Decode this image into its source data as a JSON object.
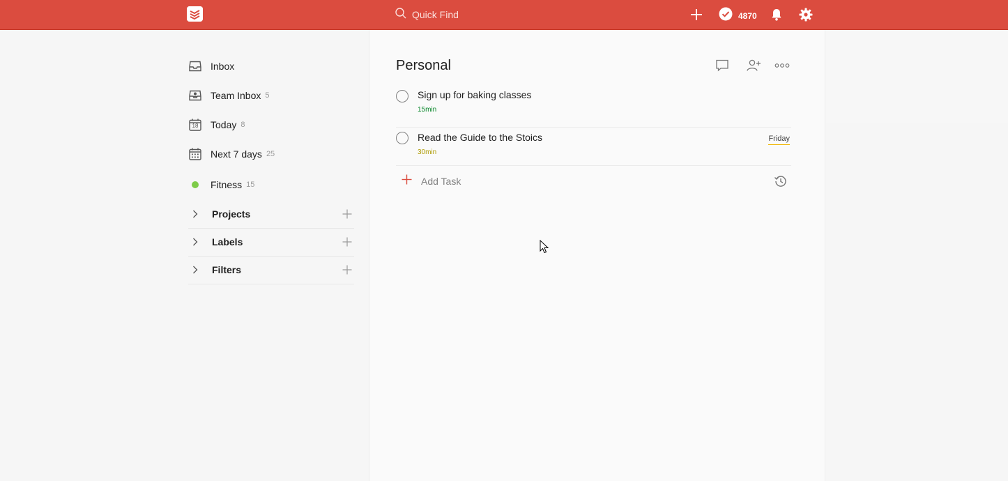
{
  "topbar": {
    "search_placeholder": "Quick Find",
    "karma_points": "4870",
    "brand_color": "#db4c3f",
    "icons": [
      "todoist-logo-icon",
      "search-icon",
      "add-icon",
      "karma-check-icon",
      "bell-icon",
      "gear-icon"
    ]
  },
  "sidebar": {
    "items": [
      {
        "label": "Inbox",
        "count": "",
        "icon": "inbox-icon"
      },
      {
        "label": "Team Inbox",
        "count": "5",
        "icon": "team-inbox-icon"
      },
      {
        "label": "Today",
        "count": "8",
        "icon": "calendar-today-icon",
        "day": "18"
      },
      {
        "label": "Next 7 days",
        "count": "25",
        "icon": "calendar-week-icon"
      },
      {
        "label": "Fitness",
        "count": "15",
        "icon": "project-dot-icon",
        "dot_color": "#7ecc49"
      }
    ],
    "sections": [
      {
        "label": "Projects"
      },
      {
        "label": "Labels"
      },
      {
        "label": "Filters"
      }
    ]
  },
  "main": {
    "title": "Personal",
    "tasks": [
      {
        "content": "Sign up for baking classes",
        "duration": "15min",
        "duration_color": "#058527",
        "due": ""
      },
      {
        "content": "Read the Guide to the Stoics",
        "duration": "30min",
        "duration_color": "#ad9a00",
        "due": "Friday"
      }
    ],
    "add_task_label": "Add Task"
  }
}
